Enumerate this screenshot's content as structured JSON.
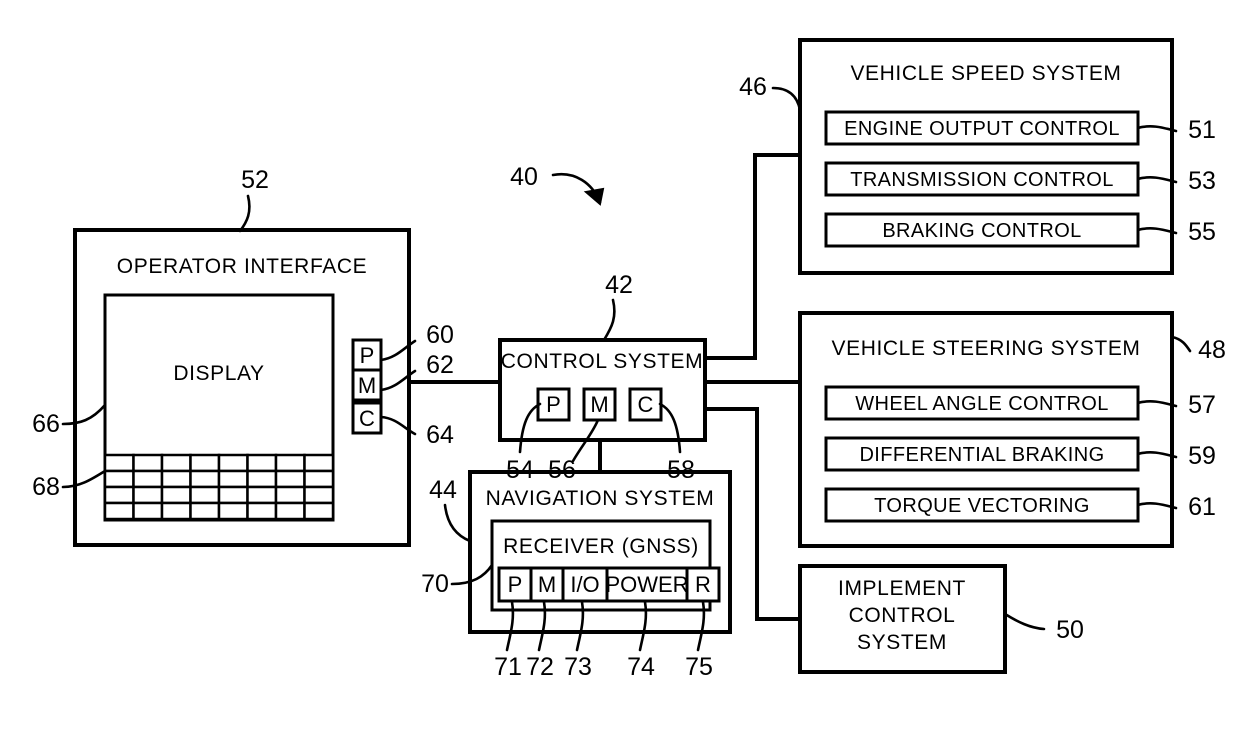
{
  "figure": {
    "title": "Vehicle control system block diagram",
    "system_reference": "40",
    "line_color": "#000000",
    "background": "#ffffff"
  },
  "operator_interface": {
    "ref": "52",
    "title": "OPERATOR  INTERFACE",
    "display": {
      "ref": "66",
      "label": "DISPLAY"
    },
    "keypad": {
      "ref": "68",
      "columns": 8,
      "rows": 4
    },
    "buttons": [
      {
        "label": "P",
        "ref": "60"
      },
      {
        "label": "M",
        "ref": "62"
      },
      {
        "label": "C",
        "ref": "64"
      }
    ]
  },
  "control_system": {
    "ref": "42",
    "title": "CONTROL  SYSTEM",
    "modules": [
      {
        "label": "P",
        "ref": "54"
      },
      {
        "label": "M",
        "ref": "56"
      },
      {
        "label": "C",
        "ref": "58"
      }
    ]
  },
  "navigation_system": {
    "ref": "44",
    "title": "NAVIGATION  SYSTEM",
    "receiver": {
      "ref": "70",
      "title": "RECEIVER  (GNSS)",
      "components": [
        {
          "label": "P",
          "ref": "71"
        },
        {
          "label": "M",
          "ref": "72"
        },
        {
          "label": "I/O",
          "ref": "73"
        },
        {
          "label": "POWER",
          "ref": "74"
        },
        {
          "label": "R",
          "ref": "75"
        }
      ]
    }
  },
  "vehicle_speed_system": {
    "ref": "46",
    "title": "VEHICLE SPEED SYSTEM",
    "controls": [
      {
        "label": "ENGINE  OUTPUT  CONTROL",
        "ref": "51"
      },
      {
        "label": "TRANSMISSION  CONTROL",
        "ref": "53"
      },
      {
        "label": "BRAKING  CONTROL",
        "ref": "55"
      }
    ]
  },
  "vehicle_steering_system": {
    "ref": "48",
    "title": "VEHICLE STEERING SYSTEM",
    "controls": [
      {
        "label": "WHEEL ANGLE CONTROL",
        "ref": "57"
      },
      {
        "label": "DIFFERENTIAL BRAKING",
        "ref": "59"
      },
      {
        "label": "TORQUE VECTORING",
        "ref": "61"
      }
    ]
  },
  "implement_control_system": {
    "ref": "50",
    "title_lines": [
      "IMPLEMENT",
      "CONTROL",
      "SYSTEM"
    ]
  }
}
